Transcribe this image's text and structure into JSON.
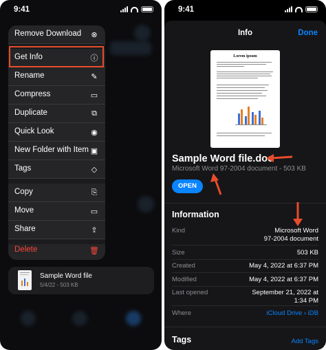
{
  "status": {
    "time": "9:41"
  },
  "menu": {
    "items": [
      {
        "label": "Remove Download",
        "icon": "x-circle-icon",
        "glyph": "⊗"
      },
      {
        "label": "Get Info",
        "icon": "info-circle-icon",
        "glyph": "ⓘ"
      },
      {
        "label": "Rename",
        "icon": "pencil-icon",
        "glyph": "✎"
      },
      {
        "label": "Compress",
        "icon": "archive-box-icon",
        "glyph": "▭"
      },
      {
        "label": "Duplicate",
        "icon": "duplicate-plus-icon",
        "glyph": "⧉"
      },
      {
        "label": "Quick Look",
        "icon": "eye-icon",
        "glyph": "◉"
      },
      {
        "label": "New Folder with Item",
        "icon": "folder-plus-icon",
        "glyph": "▣"
      },
      {
        "label": "Tags",
        "icon": "tag-icon",
        "glyph": "◇"
      },
      {
        "label": "Copy",
        "icon": "copy-icon",
        "glyph": "⎘"
      },
      {
        "label": "Move",
        "icon": "folder-icon",
        "glyph": "▭"
      },
      {
        "label": "Share",
        "icon": "share-icon",
        "glyph": "⇪"
      },
      {
        "label": "Delete",
        "icon": "trash-icon",
        "glyph": "🗑"
      }
    ]
  },
  "file_card": {
    "name": "Sample Word file",
    "meta": "5/4/22 - 503 KB"
  },
  "info": {
    "nav_title": "Info",
    "done_label": "Done",
    "preview_title": "Lorem ipsum",
    "file_name": "Sample Word file.doc",
    "file_type": "Microsoft Word 97-2004 document - 503 KB",
    "open_label": "OPEN",
    "section_title": "Information",
    "rows": [
      {
        "key": "Kind",
        "value": "Microsoft Word",
        "value2": "97-2004 document"
      },
      {
        "key": "Size",
        "value": "503 KB"
      },
      {
        "key": "Created",
        "value": "May 4, 2022 at 6:37 PM"
      },
      {
        "key": "Modified",
        "value": "May 4, 2022 at 6:37 PM"
      },
      {
        "key": "Last opened",
        "value": "September 21, 2022 at",
        "value2": "1:34 PM"
      },
      {
        "key": "Where",
        "value": "iCloud Drive › iDB"
      }
    ],
    "tags_title": "Tags",
    "add_tags_label": "Add Tags"
  },
  "colors": {
    "accent": "#0a84ff",
    "highlight": "#e74c2b",
    "destructive": "#ff453a"
  }
}
